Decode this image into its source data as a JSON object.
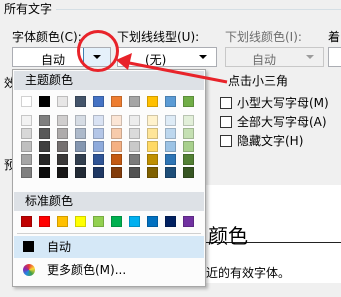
{
  "section_title": "所有文字",
  "font_color": {
    "label": "字体颜色(C):",
    "value": "自动"
  },
  "underline_style": {
    "label": "下划线线型(U):",
    "value": "(无)"
  },
  "underline_color": {
    "label": "下划线颜色(I):",
    "value": "自动"
  },
  "emphasis": {
    "label": "着"
  },
  "effects_cut_label": "效",
  "preview_cut_label": "预",
  "effects": [
    {
      "label": "小型大写字母(M)",
      "checked": false
    },
    {
      "label": "全部大写字母(A)",
      "checked": false
    },
    {
      "label": "隐藏文字(H)",
      "checked": false
    }
  ],
  "annotation": {
    "text": "点击小三角",
    "color": "#e8232a"
  },
  "preview": {
    "sample_text": "颜色",
    "note": "近的有效字体。"
  },
  "dropdown": {
    "theme_header": "主题颜色",
    "standard_header": "标准颜色",
    "theme_colors": [
      [
        "#ffffff",
        "#000000",
        "#e7e6e6",
        "#44546a",
        "#4472c4",
        "#ed7d31",
        "#a5a5a5",
        "#ffc000",
        "#5b9bd5",
        "#70ad47"
      ],
      [
        "#f2f2f2",
        "#7f7f7f",
        "#d0cece",
        "#d6dce4",
        "#d9e2f3",
        "#fbe5d5",
        "#ededed",
        "#fff2cc",
        "#deebf6",
        "#e2efd9"
      ],
      [
        "#d8d8d8",
        "#595959",
        "#aeabab",
        "#adb9ca",
        "#b4c6e7",
        "#f7cbac",
        "#dbdbdb",
        "#fee599",
        "#bdd7ee",
        "#c5e0b3"
      ],
      [
        "#bfbfbf",
        "#3f3f3f",
        "#757070",
        "#8496b0",
        "#8eaadb",
        "#f4b083",
        "#c9c9c9",
        "#ffd965",
        "#9cc3e5",
        "#a8d08d"
      ],
      [
        "#a5a5a5",
        "#262626",
        "#3a3838",
        "#323f4f",
        "#2f5496",
        "#c45911",
        "#7b7b7b",
        "#bf8f00",
        "#2e75b5",
        "#538135"
      ],
      [
        "#7f7f7f",
        "#0c0c0c",
        "#171616",
        "#222a35",
        "#1f3864",
        "#833c0b",
        "#525252",
        "#7f6000",
        "#1e4e79",
        "#375623"
      ]
    ],
    "standard_colors": [
      "#c00000",
      "#ff0000",
      "#ffc000",
      "#ffff00",
      "#92d050",
      "#00b050",
      "#00b0f0",
      "#0070c0",
      "#002060",
      "#7030a0"
    ],
    "auto_label": "自动",
    "more_label": "更多颜色(M)..."
  }
}
